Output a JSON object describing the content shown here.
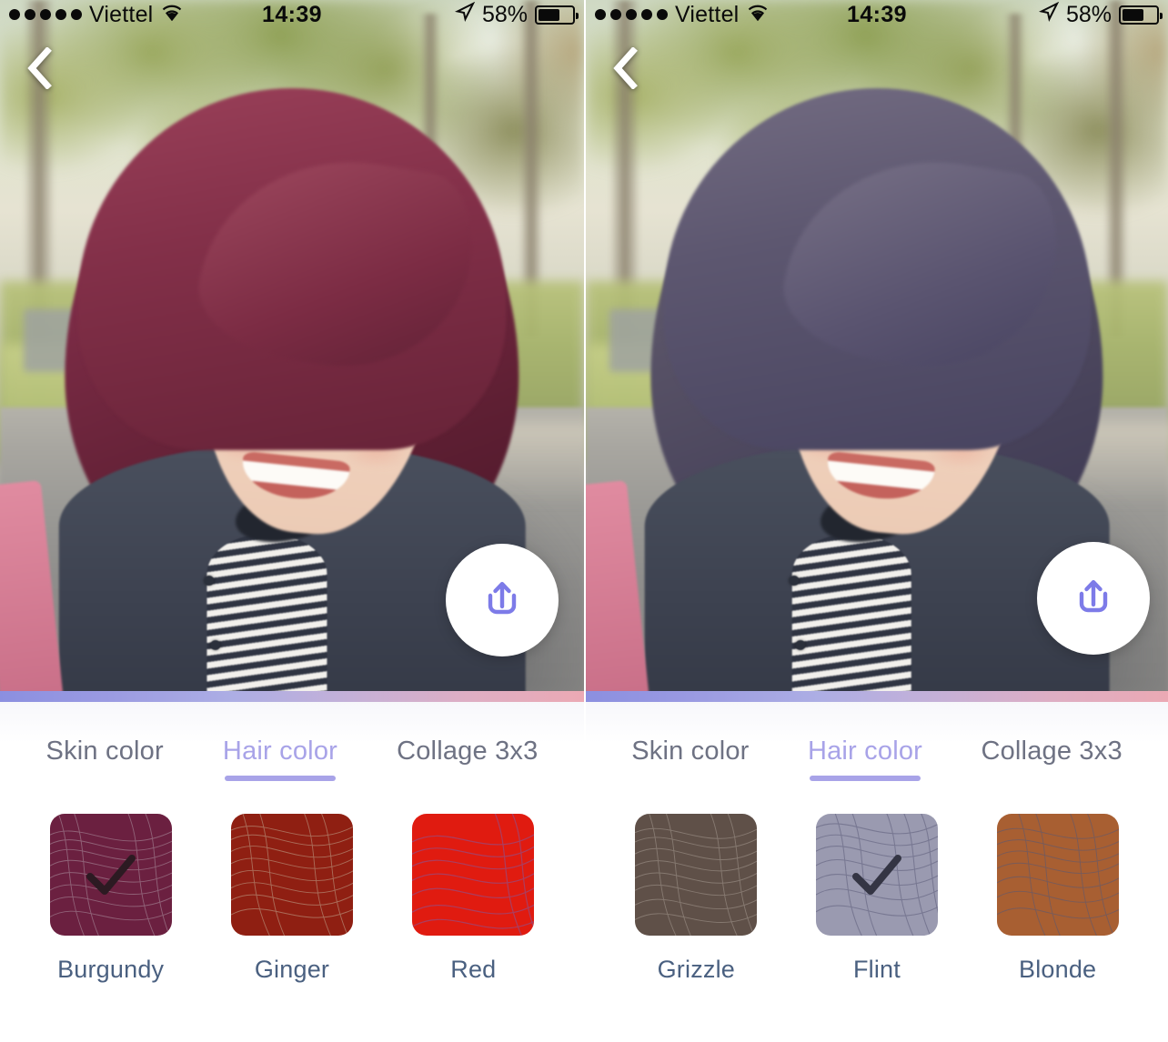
{
  "app": {
    "screens": [
      {
        "id": "left",
        "status_bar": {
          "signal_dots": 5,
          "carrier": "Viettel",
          "wifi_icon": "wifi-icon",
          "time": "14:39",
          "location_icon": "location-arrow-icon",
          "battery_percent": "58%",
          "battery_level": 58
        },
        "back_icon": "chevron-left-icon",
        "share_icon": "share-upload-icon",
        "photo": {
          "subject": "smiling young woman selfie outdoors",
          "hair_color_applied": "Burgundy",
          "scene": "park path with trees and hedge"
        },
        "tabs": [
          {
            "label": "Skin color",
            "active": false
          },
          {
            "label": "Hair color",
            "active": true
          },
          {
            "label": "Collage 3x3",
            "active": false
          }
        ],
        "swatches": [
          {
            "label": "Burgundy",
            "color": "#6b2040",
            "line_color": "#9a7285",
            "selected": true
          },
          {
            "label": "Ginger",
            "color": "#8f1f12",
            "line_color": "#b07a66",
            "selected": false
          },
          {
            "label": "Red",
            "color": "#e01b10",
            "line_color": "#9a4a7a",
            "selected": false
          }
        ]
      },
      {
        "id": "right",
        "status_bar": {
          "signal_dots": 5,
          "carrier": "Viettel",
          "wifi_icon": "wifi-icon",
          "time": "14:39",
          "location_icon": "location-arrow-icon",
          "battery_percent": "58%",
          "battery_level": 58
        },
        "back_icon": "chevron-left-icon",
        "share_icon": "share-upload-icon",
        "photo": {
          "subject": "smiling young woman selfie outdoors",
          "hair_color_applied": "Flint",
          "scene": "park path with trees and hedge"
        },
        "tabs": [
          {
            "label": "Skin color",
            "active": false
          },
          {
            "label": "Hair color",
            "active": true
          },
          {
            "label": "Collage 3x3",
            "active": false
          }
        ],
        "swatches": [
          {
            "label": "Grizzle",
            "color": "#5f5048",
            "line_color": "#8d8078",
            "selected": false
          },
          {
            "label": "Flint",
            "color": "#9a9ab0",
            "line_color": "#6a6a86",
            "selected": true
          },
          {
            "label": "Blonde",
            "color": "#a85f32",
            "line_color": "#6d5a63",
            "selected": false
          }
        ]
      }
    ],
    "theme": {
      "accent": "#a8a3e8",
      "tab_inactive": "#6e7283",
      "label_color": "#4a6080",
      "check_color": "#2c2c35",
      "gradient_start": "#8b8fe0",
      "gradient_end": "#eba9b4"
    }
  }
}
